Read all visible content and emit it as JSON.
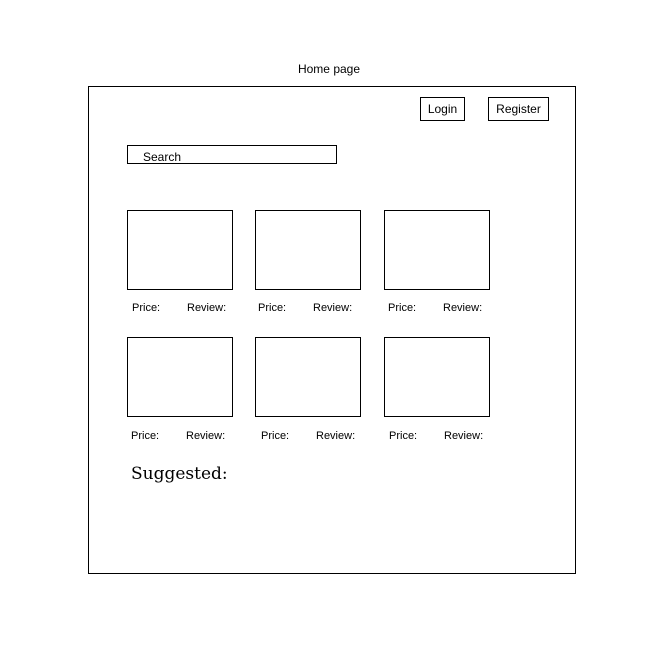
{
  "page": {
    "caption": "Home page"
  },
  "header": {
    "login_label": "Login",
    "register_label": "Register"
  },
  "search": {
    "label": "Search"
  },
  "products": [
    {
      "price_label": "Price:",
      "review_label": "Review:"
    },
    {
      "price_label": "Price:",
      "review_label": "Review:"
    },
    {
      "price_label": "Price:",
      "review_label": "Review:"
    },
    {
      "price_label": "Price:",
      "review_label": "Review:"
    },
    {
      "price_label": "Price:",
      "review_label": "Review:"
    },
    {
      "price_label": "Price:",
      "review_label": "Review:"
    }
  ],
  "suggested": {
    "label": "Suggested:"
  }
}
